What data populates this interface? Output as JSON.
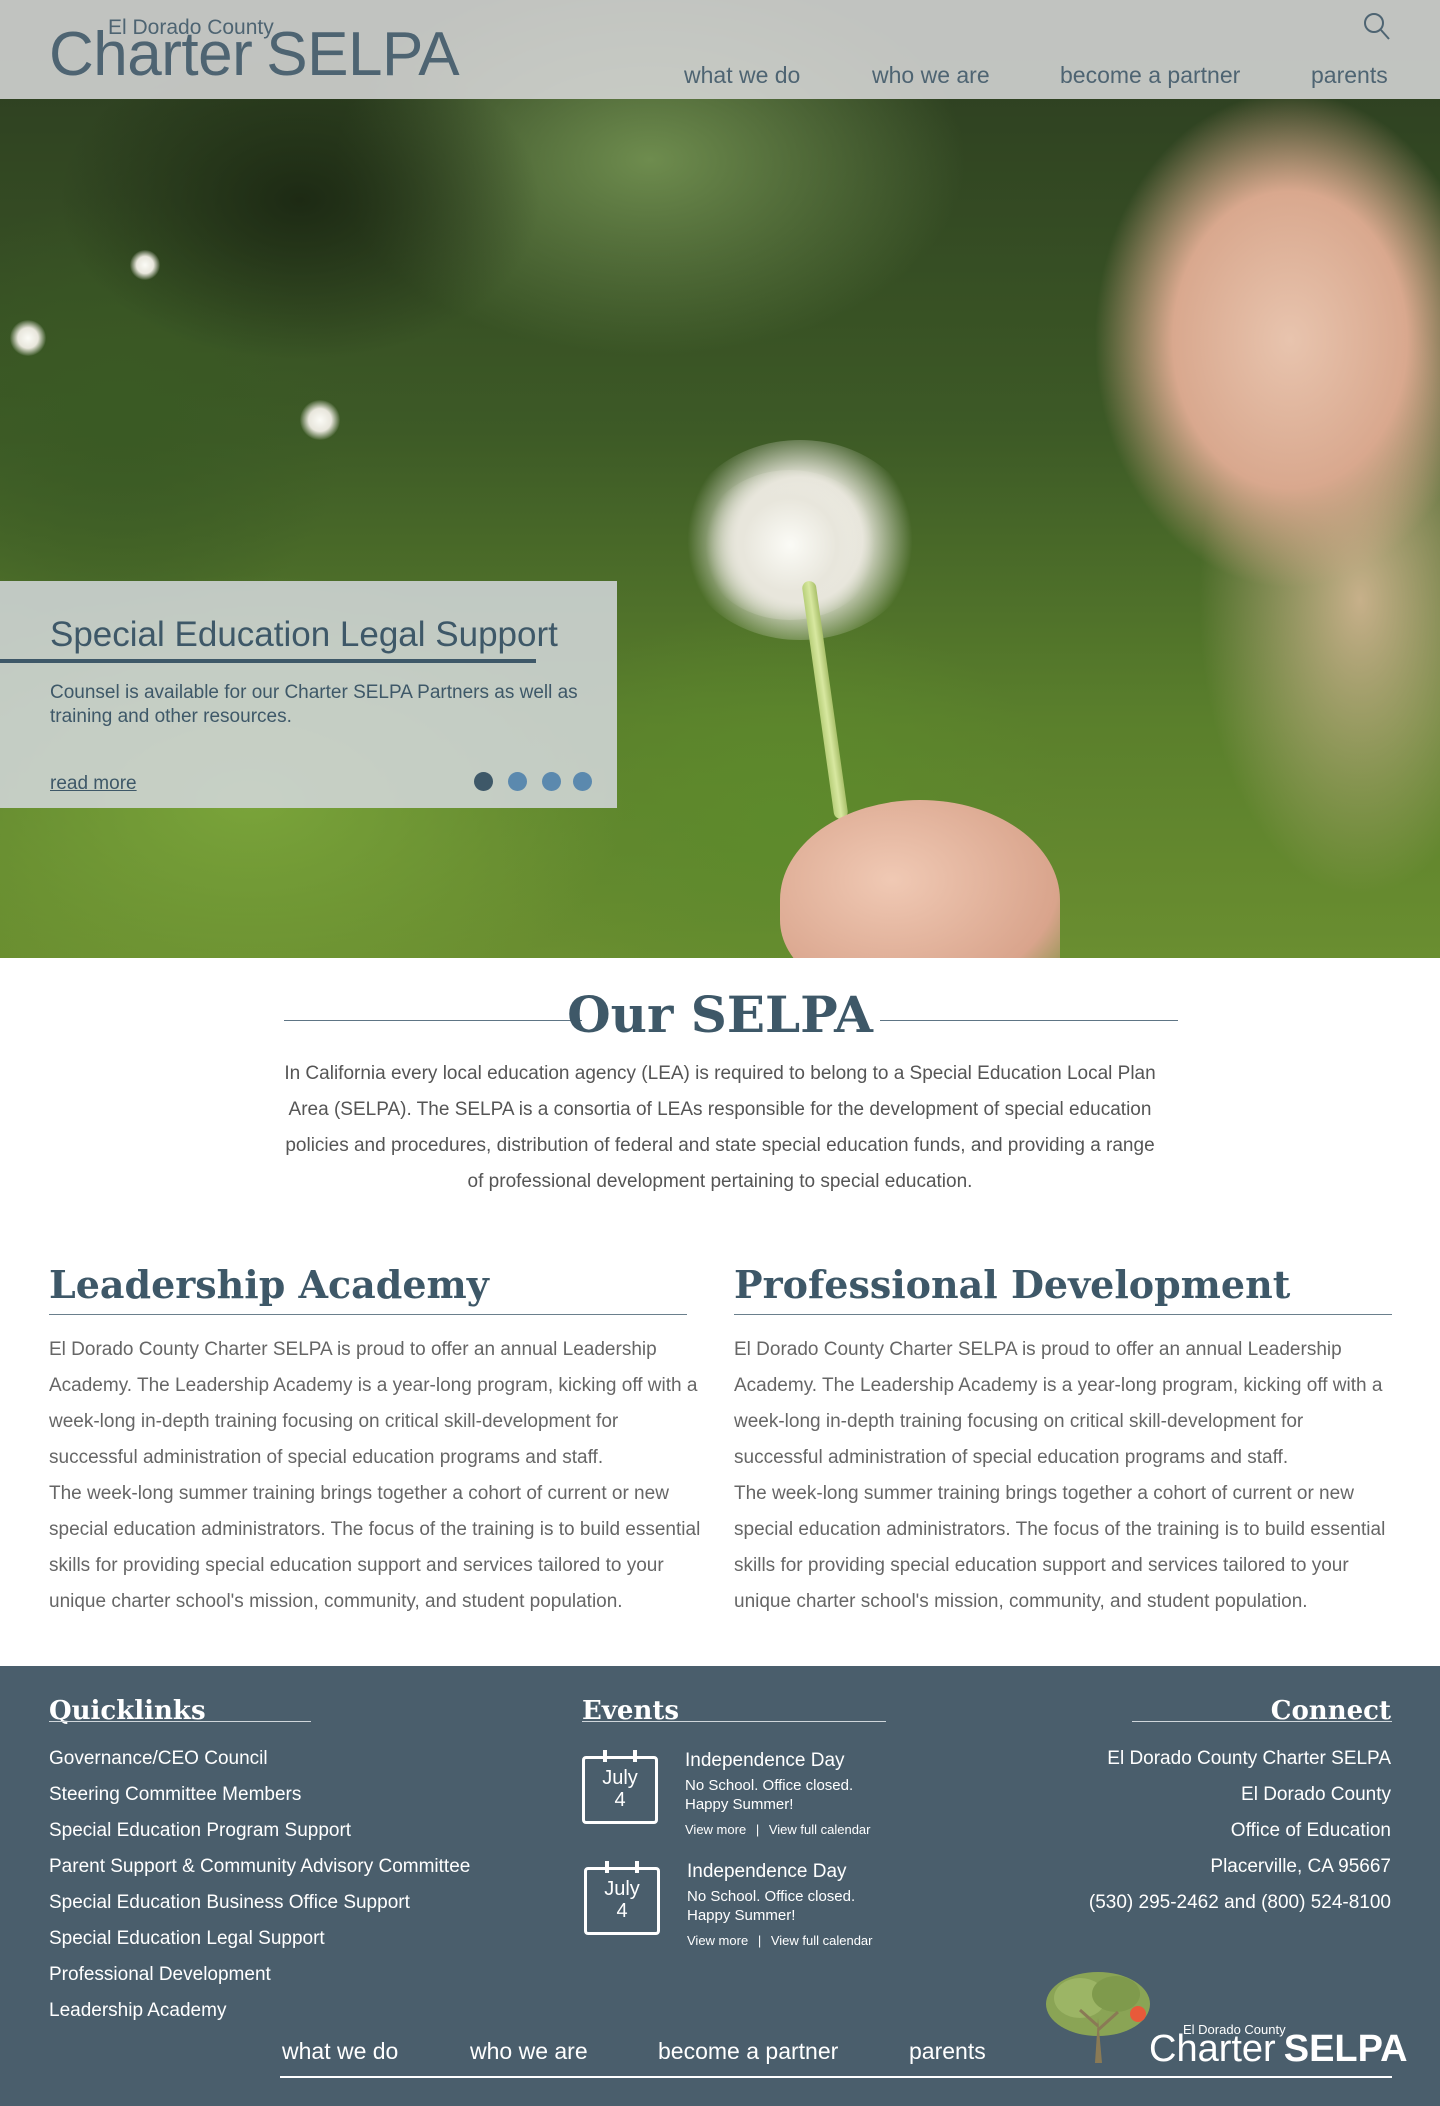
{
  "header": {
    "logo_small": "El Dorado County",
    "logo_thin": "Charter",
    "logo_bold": "SELPA",
    "nav": [
      "what we do",
      "who we are",
      "become a partner",
      "parents"
    ]
  },
  "slide": {
    "title": "Special Education Legal Support",
    "text": "Counsel is available for our Charter SELPA Partners as well as training and other resources.",
    "read_more": "read more",
    "slide_count": 4,
    "active_slide": 1
  },
  "about": {
    "title": "Our SELPA",
    "text": "In California every local education agency (LEA) is required to belong to a Special Education Local Plan Area (SELPA). The SELPA is a consortia of LEAs responsible for the development of special education policies and procedures, distribution of federal and state special education funds, and providing a range of professional development pertaining to special education."
  },
  "columns": [
    {
      "title": "Leadership Academy",
      "p1": "El Dorado County Charter SELPA is proud to offer an annual Leadership Academy. The Leadership Academy is a year-long program, kicking off with a week-long in-depth training focusing on critical skill-development for successful administration of special education programs and staff.",
      "p2": "The week-long summer training brings together a cohort of current or new special education administrators. The focus of the training is to build essential skills for providing special education support and services tailored to your unique charter school's mission, community, and student population."
    },
    {
      "title": "Professional Development",
      "p1": "El Dorado County Charter SELPA is proud to offer an annual Leadership Academy. The Leadership Academy is a year-long program, kicking off with a week-long in-depth training focusing on critical skill-development for successful administration of special education programs and staff.",
      "p2": "The week-long summer training brings together a cohort of current or new special education administrators. The focus of the training is to build essential skills for providing special education support and services tailored to your unique charter school's mission, community, and student population."
    }
  ],
  "footer": {
    "quicklinks_title": "Quicklinks",
    "quicklinks": [
      "Governance/CEO Council",
      "Steering Committee Members",
      "Special Education Program Support",
      "Parent Support & Community Advisory Committee",
      "Special Education Business Office Support",
      "Special Education Legal Support",
      "Professional Development",
      "Leadership Academy"
    ],
    "events_title": "Events",
    "events": [
      {
        "month": "July",
        "day": "4",
        "title": "Independence Day",
        "desc1": "No School. Office closed.",
        "desc2": "Happy Summer!",
        "view_more": "View more",
        "sep": "|",
        "calendar": "View full calendar"
      },
      {
        "month": "July",
        "day": "4",
        "title": "Independence Day",
        "desc1": "No School. Office closed.",
        "desc2": "Happy Summer!",
        "view_more": "View more",
        "sep": "|",
        "calendar": "View full calendar"
      }
    ],
    "connect_title": "Connect",
    "connect": [
      "El Dorado County Charter SELPA",
      "El Dorado County",
      "Office of Education",
      "Placerville, CA 95667",
      "(530) 295-2462 and (800) 524-8100"
    ],
    "nav": [
      "what we do",
      "who we are",
      "become a partner",
      "parents"
    ],
    "logo_small": "El Dorado County",
    "logo_thin": "Charter",
    "logo_bold": "SELPA"
  },
  "colors": {
    "brand": "#3e5868",
    "footer_bg": "#4a5e6c",
    "dot": "#5b89ae"
  }
}
